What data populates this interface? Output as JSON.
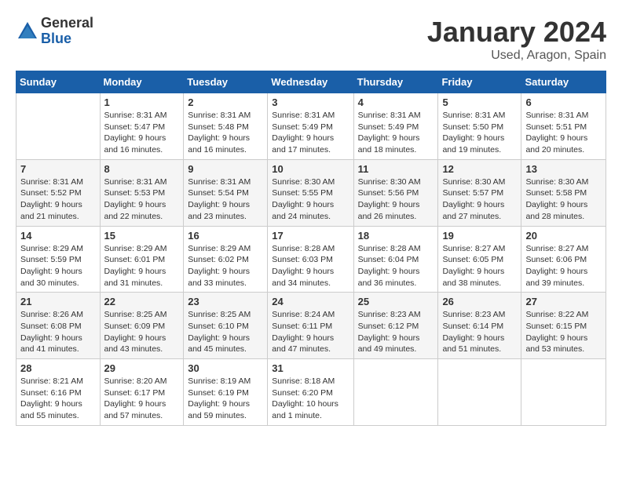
{
  "logo": {
    "general": "General",
    "blue": "Blue"
  },
  "title": "January 2024",
  "location": "Used, Aragon, Spain",
  "days_header": [
    "Sunday",
    "Monday",
    "Tuesday",
    "Wednesday",
    "Thursday",
    "Friday",
    "Saturday"
  ],
  "weeks": [
    [
      {
        "day": "",
        "info": ""
      },
      {
        "day": "1",
        "info": "Sunrise: 8:31 AM\nSunset: 5:47 PM\nDaylight: 9 hours\nand 16 minutes."
      },
      {
        "day": "2",
        "info": "Sunrise: 8:31 AM\nSunset: 5:48 PM\nDaylight: 9 hours\nand 16 minutes."
      },
      {
        "day": "3",
        "info": "Sunrise: 8:31 AM\nSunset: 5:49 PM\nDaylight: 9 hours\nand 17 minutes."
      },
      {
        "day": "4",
        "info": "Sunrise: 8:31 AM\nSunset: 5:49 PM\nDaylight: 9 hours\nand 18 minutes."
      },
      {
        "day": "5",
        "info": "Sunrise: 8:31 AM\nSunset: 5:50 PM\nDaylight: 9 hours\nand 19 minutes."
      },
      {
        "day": "6",
        "info": "Sunrise: 8:31 AM\nSunset: 5:51 PM\nDaylight: 9 hours\nand 20 minutes."
      }
    ],
    [
      {
        "day": "7",
        "info": "Sunrise: 8:31 AM\nSunset: 5:52 PM\nDaylight: 9 hours\nand 21 minutes."
      },
      {
        "day": "8",
        "info": "Sunrise: 8:31 AM\nSunset: 5:53 PM\nDaylight: 9 hours\nand 22 minutes."
      },
      {
        "day": "9",
        "info": "Sunrise: 8:31 AM\nSunset: 5:54 PM\nDaylight: 9 hours\nand 23 minutes."
      },
      {
        "day": "10",
        "info": "Sunrise: 8:30 AM\nSunset: 5:55 PM\nDaylight: 9 hours\nand 24 minutes."
      },
      {
        "day": "11",
        "info": "Sunrise: 8:30 AM\nSunset: 5:56 PM\nDaylight: 9 hours\nand 26 minutes."
      },
      {
        "day": "12",
        "info": "Sunrise: 8:30 AM\nSunset: 5:57 PM\nDaylight: 9 hours\nand 27 minutes."
      },
      {
        "day": "13",
        "info": "Sunrise: 8:30 AM\nSunset: 5:58 PM\nDaylight: 9 hours\nand 28 minutes."
      }
    ],
    [
      {
        "day": "14",
        "info": "Sunrise: 8:29 AM\nSunset: 5:59 PM\nDaylight: 9 hours\nand 30 minutes."
      },
      {
        "day": "15",
        "info": "Sunrise: 8:29 AM\nSunset: 6:01 PM\nDaylight: 9 hours\nand 31 minutes."
      },
      {
        "day": "16",
        "info": "Sunrise: 8:29 AM\nSunset: 6:02 PM\nDaylight: 9 hours\nand 33 minutes."
      },
      {
        "day": "17",
        "info": "Sunrise: 8:28 AM\nSunset: 6:03 PM\nDaylight: 9 hours\nand 34 minutes."
      },
      {
        "day": "18",
        "info": "Sunrise: 8:28 AM\nSunset: 6:04 PM\nDaylight: 9 hours\nand 36 minutes."
      },
      {
        "day": "19",
        "info": "Sunrise: 8:27 AM\nSunset: 6:05 PM\nDaylight: 9 hours\nand 38 minutes."
      },
      {
        "day": "20",
        "info": "Sunrise: 8:27 AM\nSunset: 6:06 PM\nDaylight: 9 hours\nand 39 minutes."
      }
    ],
    [
      {
        "day": "21",
        "info": "Sunrise: 8:26 AM\nSunset: 6:08 PM\nDaylight: 9 hours\nand 41 minutes."
      },
      {
        "day": "22",
        "info": "Sunrise: 8:25 AM\nSunset: 6:09 PM\nDaylight: 9 hours\nand 43 minutes."
      },
      {
        "day": "23",
        "info": "Sunrise: 8:25 AM\nSunset: 6:10 PM\nDaylight: 9 hours\nand 45 minutes."
      },
      {
        "day": "24",
        "info": "Sunrise: 8:24 AM\nSunset: 6:11 PM\nDaylight: 9 hours\nand 47 minutes."
      },
      {
        "day": "25",
        "info": "Sunrise: 8:23 AM\nSunset: 6:12 PM\nDaylight: 9 hours\nand 49 minutes."
      },
      {
        "day": "26",
        "info": "Sunrise: 8:23 AM\nSunset: 6:14 PM\nDaylight: 9 hours\nand 51 minutes."
      },
      {
        "day": "27",
        "info": "Sunrise: 8:22 AM\nSunset: 6:15 PM\nDaylight: 9 hours\nand 53 minutes."
      }
    ],
    [
      {
        "day": "28",
        "info": "Sunrise: 8:21 AM\nSunset: 6:16 PM\nDaylight: 9 hours\nand 55 minutes."
      },
      {
        "day": "29",
        "info": "Sunrise: 8:20 AM\nSunset: 6:17 PM\nDaylight: 9 hours\nand 57 minutes."
      },
      {
        "day": "30",
        "info": "Sunrise: 8:19 AM\nSunset: 6:19 PM\nDaylight: 9 hours\nand 59 minutes."
      },
      {
        "day": "31",
        "info": "Sunrise: 8:18 AM\nSunset: 6:20 PM\nDaylight: 10 hours\nand 1 minute."
      },
      {
        "day": "",
        "info": ""
      },
      {
        "day": "",
        "info": ""
      },
      {
        "day": "",
        "info": ""
      }
    ]
  ]
}
